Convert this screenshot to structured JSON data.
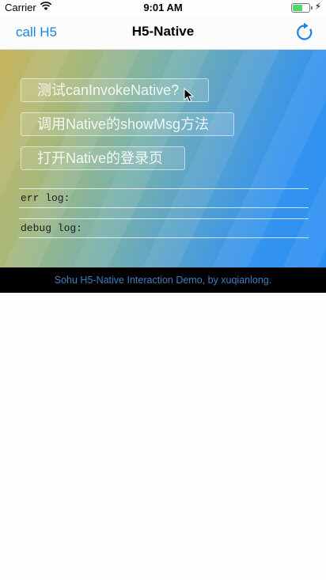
{
  "status_bar": {
    "carrier": "Carrier",
    "time": "9:01 AM",
    "battery_level": 0.6,
    "charging": true
  },
  "nav": {
    "left_button": "call H5",
    "title": "H5-Native",
    "right_icon": "refresh-icon",
    "accent_color": "#1a82e2"
  },
  "web": {
    "buttons": [
      {
        "label": "测试canInvokeNative?"
      },
      {
        "label": "调用Native的showMsg方法"
      },
      {
        "label": "打开Native的登录页"
      }
    ],
    "err_log_label": "err log:",
    "debug_log_label": "debug log:"
  },
  "footer": {
    "text": "Sohu H5-Native Interaction Demo, by xuqianlong."
  }
}
